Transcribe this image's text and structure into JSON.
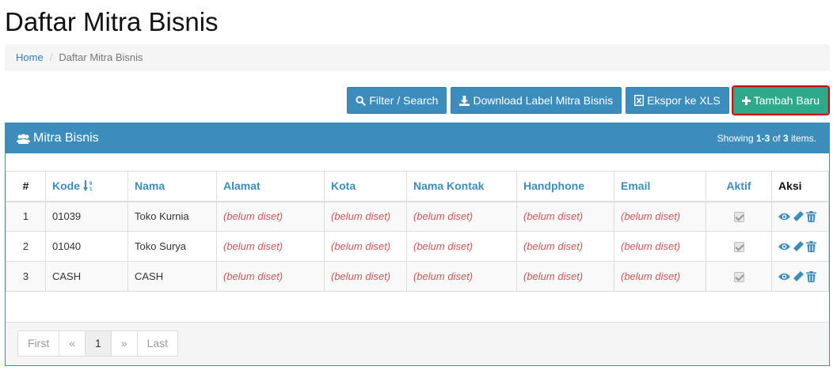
{
  "page": {
    "title": "Daftar Mitra Bisnis"
  },
  "breadcrumb": {
    "home": "Home",
    "current": "Daftar Mitra Bisnis"
  },
  "toolbar": {
    "filter_label": "Filter / Search",
    "download_label": "Download Label Mitra Bisnis",
    "export_label": "Ekspor ke XLS",
    "add_label": "Tambah Baru"
  },
  "panel": {
    "title": "Mitra Bisnis",
    "summary_prefix": "Showing ",
    "summary_range": "1-3",
    "summary_mid": " of ",
    "summary_total": "3",
    "summary_suffix": " items."
  },
  "table": {
    "headers": {
      "num": "#",
      "kode": "Kode",
      "nama": "Nama",
      "alamat": "Alamat",
      "kota": "Kota",
      "kontak": "Nama Kontak",
      "hp": "Handphone",
      "email": "Email",
      "aktif": "Aktif",
      "aksi": "Aksi"
    },
    "rows": [
      {
        "num": "1",
        "kode": "01039",
        "nama": "Toko Kurnia",
        "alamat": "(belum diset)",
        "kota": "(belum diset)",
        "kontak": "(belum diset)",
        "hp": "(belum diset)",
        "email": "(belum diset)",
        "aktif": true
      },
      {
        "num": "2",
        "kode": "01040",
        "nama": "Toko Surya",
        "alamat": "(belum diset)",
        "kota": "(belum diset)",
        "kontak": "(belum diset)",
        "hp": "(belum diset)",
        "email": "(belum diset)",
        "aktif": true
      },
      {
        "num": "3",
        "kode": "CASH",
        "nama": "CASH",
        "alamat": "(belum diset)",
        "kota": "(belum diset)",
        "kontak": "(belum diset)",
        "hp": "(belum diset)",
        "email": "(belum diset)",
        "aktif": true
      }
    ]
  },
  "pagination": {
    "first": "First",
    "prev": "«",
    "current": "1",
    "next": "»",
    "last": "Last"
  },
  "icons": {
    "filter": "search-icon",
    "download": "download-icon",
    "export": "file-excel-icon",
    "add": "plus-icon",
    "panel": "users-icon",
    "sort": "sort-numeric-asc-icon",
    "view": "eye-icon",
    "edit": "pencil-icon",
    "delete": "trash-icon"
  },
  "colors": {
    "primary": "#3c8dbc",
    "success": "#2fa98c",
    "highlight": "#d9000d",
    "notset": "#cc5555"
  }
}
